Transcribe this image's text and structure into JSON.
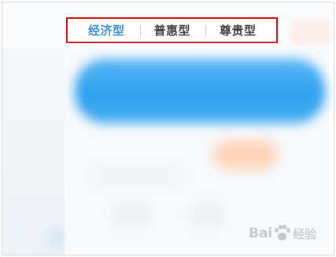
{
  "tabs": {
    "items": [
      {
        "label": "经济型",
        "active": true
      },
      {
        "label": "普惠型",
        "active": false
      },
      {
        "label": "尊贵型",
        "active": false
      }
    ],
    "active_color": "#3d8fd6",
    "inactive_color": "#444444",
    "highlight_border_color": "#d61a1a"
  },
  "banner": {
    "color": "#2fa0ee"
  },
  "watermark": {
    "text_left": "Bai",
    "text_right": "经验",
    "icon": "paw-icon"
  }
}
